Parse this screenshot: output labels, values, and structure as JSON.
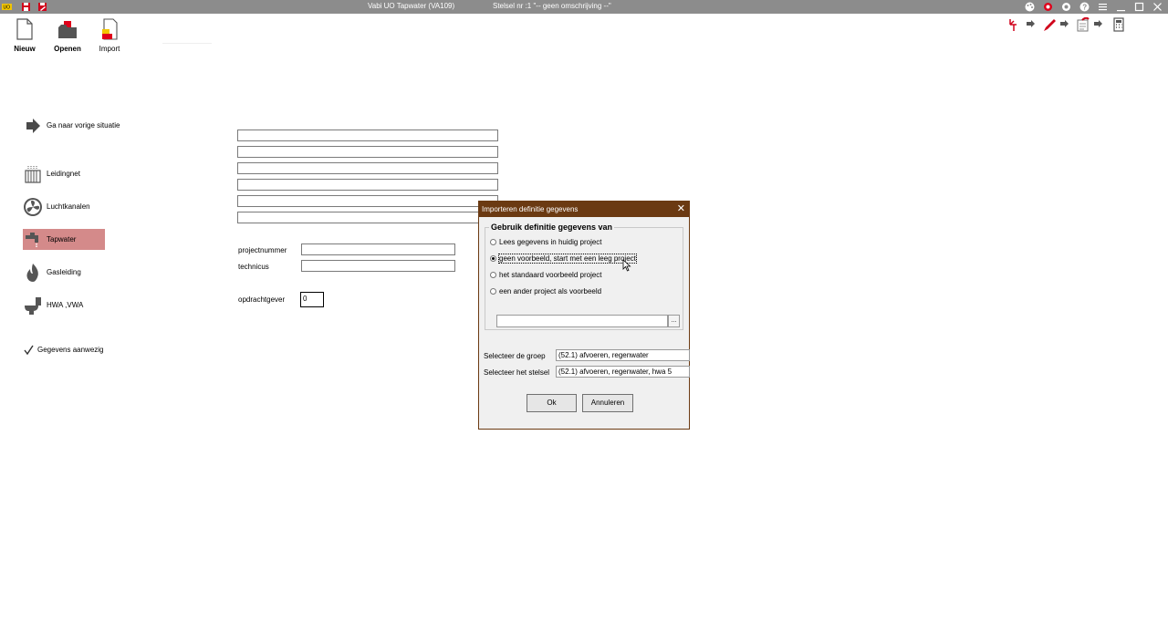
{
  "titlebar": {
    "app_title": "Vabi UO Tapwater (VA109)",
    "stelsel": "Stelsel nr  :1  \"-- geen omschrijving --\"",
    "left_icons": [
      "uo-logo-icon",
      "save-icon",
      "save-as-icon"
    ],
    "right_icons": [
      "palette-icon",
      "settings-gear-icon",
      "settings-gear-alt-icon",
      "help-icon",
      "menu-icon",
      "minimize-icon",
      "maximize-icon",
      "close-icon"
    ]
  },
  "ribbon": {
    "new_label": "Nieuw",
    "open_label": "Openen",
    "import_label": "Import"
  },
  "toolbar_right": {
    "icons": [
      "pipe-split-icon",
      "pencil-icon",
      "notes-icon",
      "calculator-icon"
    ]
  },
  "sidebar": {
    "back_label": "Ga naar vorige situatie",
    "items": [
      {
        "label": "Leidingnet",
        "icon": "radiator-icon"
      },
      {
        "label": "Luchtkanalen",
        "icon": "fan-icon"
      },
      {
        "label": "Tapwater",
        "icon": "faucet-icon"
      },
      {
        "label": "Gasleiding",
        "icon": "flame-icon"
      },
      {
        "label": "HWA ,VWA",
        "icon": "toilet-icon"
      }
    ],
    "data_present_label": "Gegevens aanwezig"
  },
  "form": {
    "projectnummer_label": "projectnummer",
    "technicus_label": "technicus",
    "opdrachtgever_label": "opdrachtgever",
    "opdrachtgever_value": "0"
  },
  "dialog": {
    "title": "Importeren definitie gegevens",
    "group_title": "Gebruik definitie gegevens van",
    "options": [
      {
        "label": "Lees gegevens in huidig project",
        "selected": false
      },
      {
        "label": "geen voorbeeld, start met een leeg project",
        "selected": true
      },
      {
        "label": "het standaard voorbeeld project",
        "selected": false
      },
      {
        "label": "een ander project als voorbeeld",
        "selected": false
      }
    ],
    "browse_label": "...",
    "group_label": "Selecteer de groep",
    "group_value": "(52.1) afvoeren, regenwater",
    "stelsel_label": "Selecteer het stelsel",
    "stelsel_value": "(52.1) afvoeren, regenwater, hwa 5",
    "ok_label": "Ok",
    "cancel_label": "Annuleren"
  },
  "colors": {
    "titlebar": "#8c8c8c",
    "dialog_title": "#6b3a12",
    "active_sidebar": "#d48a8a",
    "accent_red": "#e0001a"
  }
}
